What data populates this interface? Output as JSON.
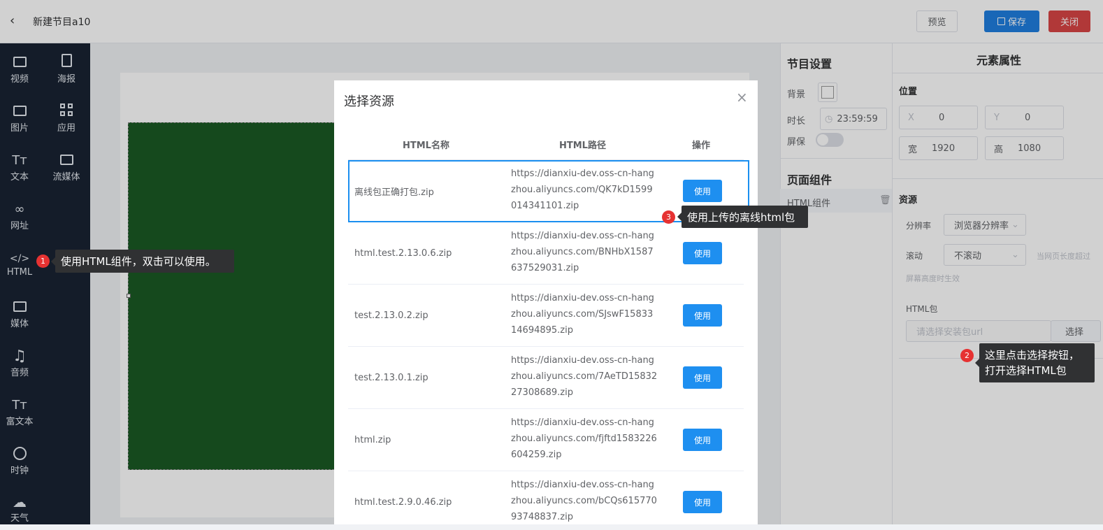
{
  "header": {
    "back_icon": "chevron-left-icon",
    "title": "新建节目a10",
    "preview_label": "预览",
    "save_label": "保存",
    "close_label": "关闭"
  },
  "sidebar": {
    "items": [
      {
        "label": "视频",
        "icon": "video-icon"
      },
      {
        "label": "海报",
        "icon": "poster-icon"
      },
      {
        "label": "图片",
        "icon": "image-icon"
      },
      {
        "label": "应用",
        "icon": "apps-icon"
      },
      {
        "label": "文本",
        "icon": "text-icon"
      },
      {
        "label": "流媒体",
        "icon": "stream-icon"
      },
      {
        "label": "网址",
        "icon": "link-icon"
      },
      {
        "label": "HTML",
        "icon": "code-icon"
      },
      {
        "label": "媒体",
        "icon": "media-icon"
      },
      {
        "label": "音频",
        "icon": "music-icon"
      },
      {
        "label": "富文本",
        "icon": "richtext-icon"
      },
      {
        "label": "时钟",
        "icon": "clock-icon"
      },
      {
        "label": "天气",
        "icon": "cloud-icon"
      }
    ]
  },
  "program_settings": {
    "title": "节目设置",
    "bg_label": "背景",
    "duration_label": "时长",
    "duration_value": "23:59:59",
    "screensaver_label": "屏保",
    "components_title": "页面组件",
    "component_item": "HTML组件"
  },
  "element_props": {
    "title": "元素属性",
    "position_title": "位置",
    "x_label": "X",
    "x_value": "0",
    "y_label": "Y",
    "y_value": "0",
    "w_label": "宽",
    "w_value": "1920",
    "h_label": "高",
    "h_value": "1080",
    "resource_title": "资源",
    "resolution_label": "分辨率",
    "resolution_value": "浏览器分辨率",
    "scroll_label": "滚动",
    "scroll_value": "不滚动",
    "scroll_hint": "当网页长度超过",
    "scroll_hint2": "屏幕高度时生效",
    "html_pkg_label": "HTML包",
    "html_pkg_placeholder": "请选择安装包url",
    "select_button": "选择"
  },
  "dialog": {
    "title": "选择资源",
    "columns": [
      "HTML名称",
      "HTML路径",
      "操作"
    ],
    "use_label": "使用",
    "rows": [
      {
        "name": "离线包正确打包.zip",
        "path": "https://dianxiu-dev.oss-cn-hangzhou.aliyuncs.com/QK7kD1599014341101.zip"
      },
      {
        "name": "html.test.2.13.0.6.zip",
        "path": "https://dianxiu-dev.oss-cn-hangzhou.aliyuncs.com/BNHbX1587637529031.zip"
      },
      {
        "name": "test.2.13.0.2.zip",
        "path": "https://dianxiu-dev.oss-cn-hangzhou.aliyuncs.com/SJswF1583314694895.zip"
      },
      {
        "name": "test.2.13.0.1.zip",
        "path": "https://dianxiu-dev.oss-cn-hangzhou.aliyuncs.com/7AeTD1583227308689.zip"
      },
      {
        "name": "html.zip",
        "path": "https://dianxiu-dev.oss-cn-hangzhou.aliyuncs.com/fjftd1583226604259.zip"
      },
      {
        "name": "html.test.2.9.0.46.zip",
        "path": "https://dianxiu-dev.oss-cn-hangzhou.aliyuncs.com/bCQs61577093748837.zip"
      }
    ]
  },
  "tips": {
    "t1_num": "1",
    "t1_text": "使用HTML组件，双击可以使用。",
    "t2_num": "2",
    "t2_line1": "这里点击选择按钮，",
    "t2_line2": "打开选择HTML包",
    "t3_num": "3",
    "t3_text": "使用上传的离线html包"
  },
  "colors": {
    "primary": "#1e8ff0",
    "danger": "#d84545",
    "sidebar": "#192332",
    "canvas_green": "#1a5a24"
  }
}
